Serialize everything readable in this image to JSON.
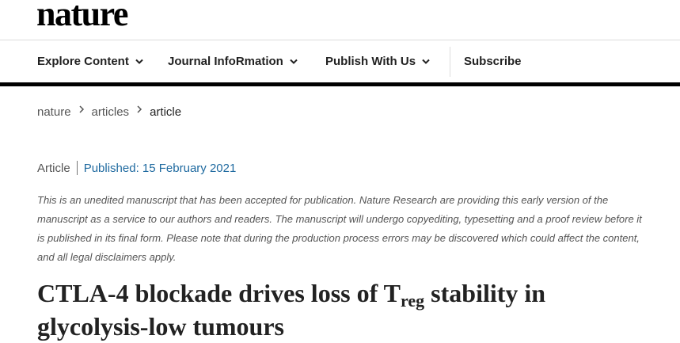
{
  "site": {
    "logo": "nature"
  },
  "nav": {
    "items": [
      {
        "label": "Explore Content"
      },
      {
        "label": "Journal InfoRmation"
      },
      {
        "label": "Publish With Us"
      }
    ],
    "subscribe": "Subscribe"
  },
  "breadcrumb": [
    "nature",
    "articles",
    "article"
  ],
  "article": {
    "type": "Article",
    "published": "Published: 15 February 2021",
    "notice": "This is an unedited manuscript that has been accepted for publication. Nature Research are providing this early version of the manuscript as a service to our authors and readers. The manuscript will undergo copyediting, typesetting and a proof review before it is published in its final form. Please note that during the production process errors may be discovered which could affect the content, and all legal disclaimers apply.",
    "title_before": "CTLA-4 blockade drives loss of T",
    "title_sub": "reg",
    "title_after": " stability in",
    "title_line2": "glycolysis-low tumours"
  },
  "icons": {
    "nav_dropdown": "chevron-down-icon",
    "breadcrumb_separator": "chevron-right-icon"
  },
  "colors": {
    "published_link": "#1f6aa0",
    "rule": "#000000"
  }
}
